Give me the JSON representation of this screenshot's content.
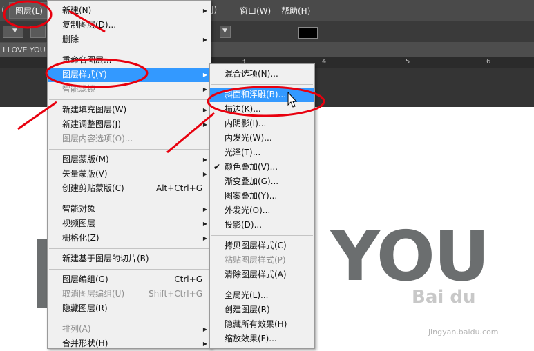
{
  "menubar": {
    "left_fragment": "(",
    "layer_menu": "图层(L)",
    "window_menu": "窗口(W)",
    "help_menu": "帮助(H)",
    "partial_menu": "J)"
  },
  "document": {
    "tab_title": "I LOVE YOU,",
    "ruler_ticks": [
      "3",
      "4",
      "5",
      "6"
    ],
    "canvas_text": "YOU"
  },
  "layer_menu": {
    "items": [
      {
        "label": "新建(N)",
        "submenu": true
      },
      {
        "label": "复制图层(D)..."
      },
      {
        "label": "删除",
        "submenu": true
      },
      {
        "sep": true
      },
      {
        "label": "重命名图层..."
      },
      {
        "label": "图层样式(Y)",
        "submenu": true,
        "highlighted": true
      },
      {
        "label": "智能滤镜",
        "submenu": true,
        "disabled": true
      },
      {
        "sep": true
      },
      {
        "label": "新建填充图层(W)",
        "submenu": true
      },
      {
        "label": "新建调整图层(J)",
        "submenu": true
      },
      {
        "label": "图层内容选项(O)...",
        "disabled": true
      },
      {
        "sep": true
      },
      {
        "label": "图层蒙版(M)",
        "submenu": true
      },
      {
        "label": "矢量蒙版(V)",
        "submenu": true
      },
      {
        "label": "创建剪贴蒙版(C)",
        "shortcut": "Alt+Ctrl+G"
      },
      {
        "sep": true
      },
      {
        "label": "智能对象",
        "submenu": true
      },
      {
        "label": "视频图层",
        "submenu": true
      },
      {
        "label": "栅格化(Z)",
        "submenu": true
      },
      {
        "sep": true
      },
      {
        "label": "新建基于图层的切片(B)"
      },
      {
        "sep": true
      },
      {
        "label": "图层编组(G)",
        "shortcut": "Ctrl+G"
      },
      {
        "label": "取消图层编组(U)",
        "shortcut": "Shift+Ctrl+G",
        "disabled": true
      },
      {
        "label": "隐藏图层(R)"
      },
      {
        "sep": true
      },
      {
        "label": "排列(A)",
        "submenu": true,
        "disabled": true
      },
      {
        "label": "合并形状(H)",
        "submenu": true
      }
    ]
  },
  "style_submenu": {
    "items": [
      {
        "label": "混合选项(N)..."
      },
      {
        "sep": true
      },
      {
        "label": "斜面和浮雕(B)...",
        "highlighted": true
      },
      {
        "label": "描边(K)..."
      },
      {
        "label": "内阴影(I)..."
      },
      {
        "label": "内发光(W)..."
      },
      {
        "label": "光泽(T)..."
      },
      {
        "label": "颜色叠加(V)...",
        "checked": true
      },
      {
        "label": "渐变叠加(G)..."
      },
      {
        "label": "图案叠加(Y)..."
      },
      {
        "label": "外发光(O)..."
      },
      {
        "label": "投影(D)..."
      },
      {
        "sep": true
      },
      {
        "label": "拷贝图层样式(C)"
      },
      {
        "label": "粘贴图层样式(P)",
        "disabled": true
      },
      {
        "label": "清除图层样式(A)"
      },
      {
        "sep": true
      },
      {
        "label": "全局光(L)..."
      },
      {
        "label": "创建图层(R)"
      },
      {
        "label": "隐藏所有效果(H)"
      },
      {
        "label": "缩放效果(F)..."
      }
    ]
  },
  "watermark": {
    "brand": "Bai du",
    "url": "jingyan.baidu.com"
  },
  "colors": {
    "highlight": "#3399ff",
    "annotation_red": "#e8000e",
    "canvas_text": "#6b6e6f"
  }
}
